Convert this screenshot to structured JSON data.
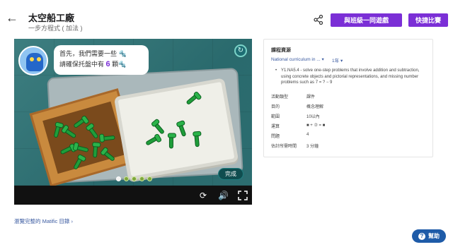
{
  "header": {
    "title": "太空船工廠",
    "subtitle": "一步方程式 ( 加法 )",
    "play_class_label": "與班級一同遊戲",
    "compete_label": "快捷比賽"
  },
  "game": {
    "speech_prefix": "首先，我們需要一些",
    "speech_line2_prefix": "請確保托盤中有",
    "speech_number": "6",
    "speech_unit": "顆",
    "done_label": "完成",
    "progress": {
      "total": 5,
      "current": 1
    }
  },
  "info": {
    "heading": "課程資源",
    "curriculum": "National curriculum in ...",
    "year": "1年",
    "standard": "Y1.NA5.4 - solve one-step problems that involve addition and subtraction, using concrete objects and pictorial representations, and missing number problems such as 7 = ? − 9",
    "props": [
      {
        "label": "活動類型",
        "value": "課件"
      },
      {
        "label": "目的",
        "value": "概念理解"
      },
      {
        "label": "範圍",
        "value": "10以內"
      },
      {
        "label": "運算",
        "value": "■ + ⑦ = ■"
      },
      {
        "label": "問題",
        "value": "4"
      },
      {
        "label": "估計所需時間",
        "value": "3 分鐘"
      }
    ]
  },
  "footer": {
    "catalog_link": "瀏覽完整的 Matific 目錄",
    "help_label": "幫助"
  },
  "colors": {
    "accent": "#7b2fd6",
    "help": "#1e5ba8",
    "link": "#3a5aa0"
  }
}
